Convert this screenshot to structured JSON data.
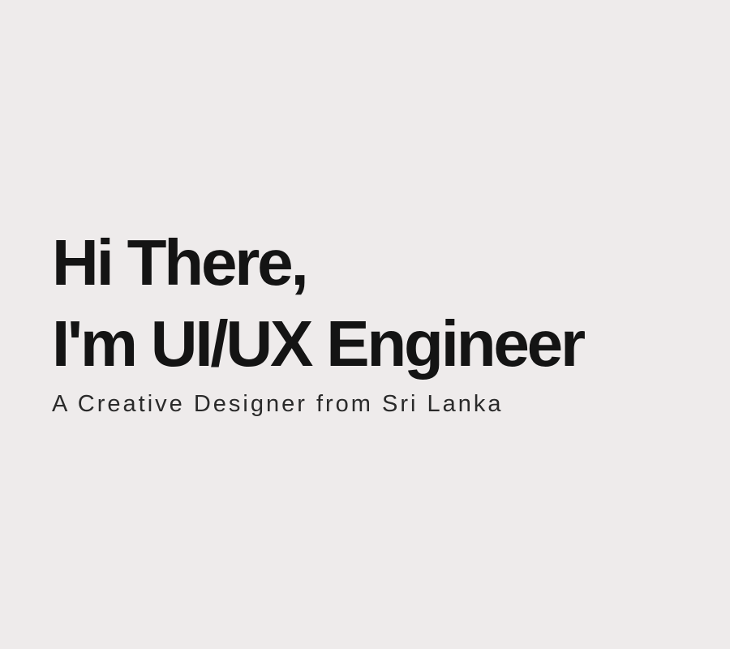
{
  "hero": {
    "headline_line1": "Hi There,",
    "headline_line2": "I'm UI/UX Engineer",
    "tagline": "A Creative Designer from Sri Lanka"
  },
  "colors": {
    "background": "#eeebeb",
    "text": "#141414"
  }
}
